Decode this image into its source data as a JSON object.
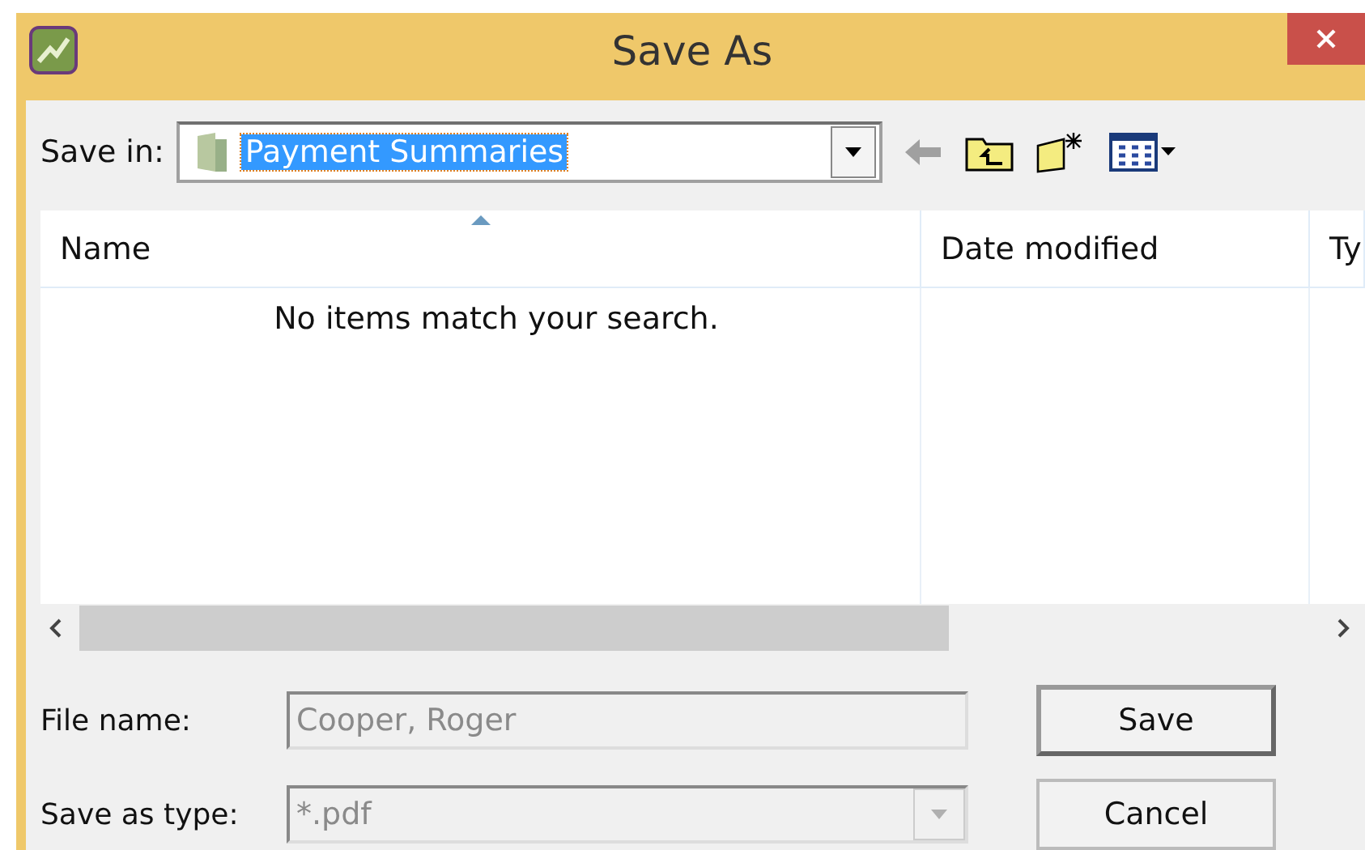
{
  "window": {
    "title": "Save As"
  },
  "save_in": {
    "label": "Save in:",
    "value": "Payment Summaries",
    "selected": true
  },
  "columns": [
    {
      "label": "Name",
      "sorted": true
    },
    {
      "label": "Date modified",
      "sorted": false
    },
    {
      "label": "Ty",
      "sorted": false
    }
  ],
  "empty_message": "No items match your search.",
  "file_name": {
    "label": "File name:",
    "value": "Cooper, Roger",
    "disabled": true
  },
  "save_as_type": {
    "label": "Save as type:",
    "value": "*.pdf",
    "disabled": true
  },
  "buttons": [
    {
      "label": "Save",
      "default": true
    },
    {
      "label": "Cancel",
      "default": false
    }
  ]
}
